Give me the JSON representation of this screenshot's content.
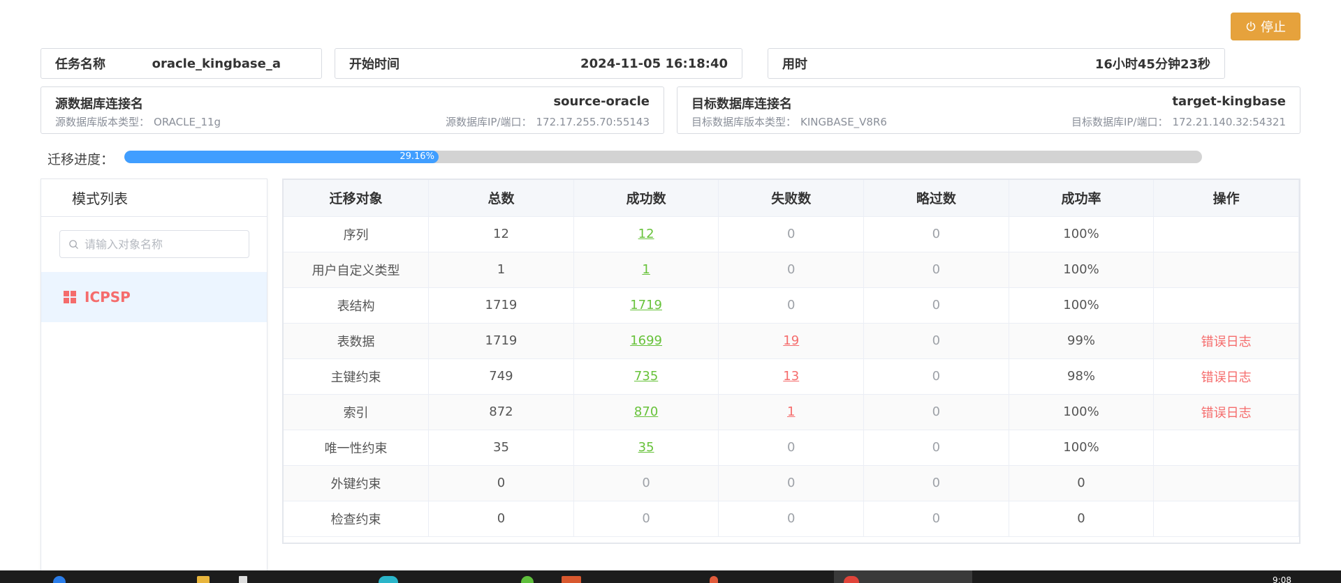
{
  "header": {
    "stop_label": "停止",
    "task_name_label": "任务名称",
    "task_name_value": "oracle_kingbase_a",
    "start_time_label": "开始时间",
    "start_time_value": "2024-11-05 16:18:40",
    "elapsed_label": "用时",
    "elapsed_value": "16小时45分钟23秒"
  },
  "source": {
    "title": "源数据库连接名",
    "name": "source-oracle",
    "version_label": "源数据库版本类型：",
    "version_value": "ORACLE_11g",
    "addr_label": "源数据库IP/端口：",
    "addr_value": "172.17.255.70:55143"
  },
  "target": {
    "title": "目标数据库连接名",
    "name": "target-kingbase",
    "version_label": "目标数据库版本类型：",
    "version_value": "KINGBASE_V8R6",
    "addr_label": "目标数据库IP/端口：",
    "addr_value": "172.21.140.32:54321"
  },
  "progress": {
    "label": "迁移进度：",
    "percent_text": "29.16%",
    "fraction": 0.2916
  },
  "sidebar": {
    "title": "模式列表",
    "search_placeholder": "请输入对象名称",
    "schemas": [
      "ICPSP"
    ]
  },
  "table": {
    "headers": [
      "迁移对象",
      "总数",
      "成功数",
      "失败数",
      "略过数",
      "成功率",
      "操作"
    ],
    "rows": [
      {
        "object": "序列",
        "total": "12",
        "success": "12",
        "failed": "0",
        "skipped": "0",
        "rate": "100%",
        "action": ""
      },
      {
        "object": "用户自定义类型",
        "total": "1",
        "success": "1",
        "failed": "0",
        "skipped": "0",
        "rate": "100%",
        "action": ""
      },
      {
        "object": "表结构",
        "total": "1719",
        "success": "1719",
        "failed": "0",
        "skipped": "0",
        "rate": "100%",
        "action": ""
      },
      {
        "object": "表数据",
        "total": "1719",
        "success": "1699",
        "failed": "19",
        "skipped": "0",
        "rate": "99%",
        "action": "错误日志"
      },
      {
        "object": "主键约束",
        "total": "749",
        "success": "735",
        "failed": "13",
        "skipped": "0",
        "rate": "98%",
        "action": "错误日志"
      },
      {
        "object": "索引",
        "total": "872",
        "success": "870",
        "failed": "1",
        "skipped": "0",
        "rate": "100%",
        "action": "错误日志"
      },
      {
        "object": "唯一性约束",
        "total": "35",
        "success": "35",
        "failed": "0",
        "skipped": "0",
        "rate": "100%",
        "action": ""
      },
      {
        "object": "外键约束",
        "total": "0",
        "success": "0",
        "failed": "0",
        "skipped": "0",
        "rate": "0",
        "action": ""
      },
      {
        "object": "检查约束",
        "total": "0",
        "success": "0",
        "failed": "0",
        "skipped": "0",
        "rate": "0",
        "action": ""
      }
    ]
  },
  "taskbar": {
    "clock": "9:08"
  },
  "colors": {
    "accent_blue": "#409eff",
    "warning_orange": "#e6a23c",
    "success_green": "#67c23a",
    "danger_red": "#f56c6c"
  }
}
